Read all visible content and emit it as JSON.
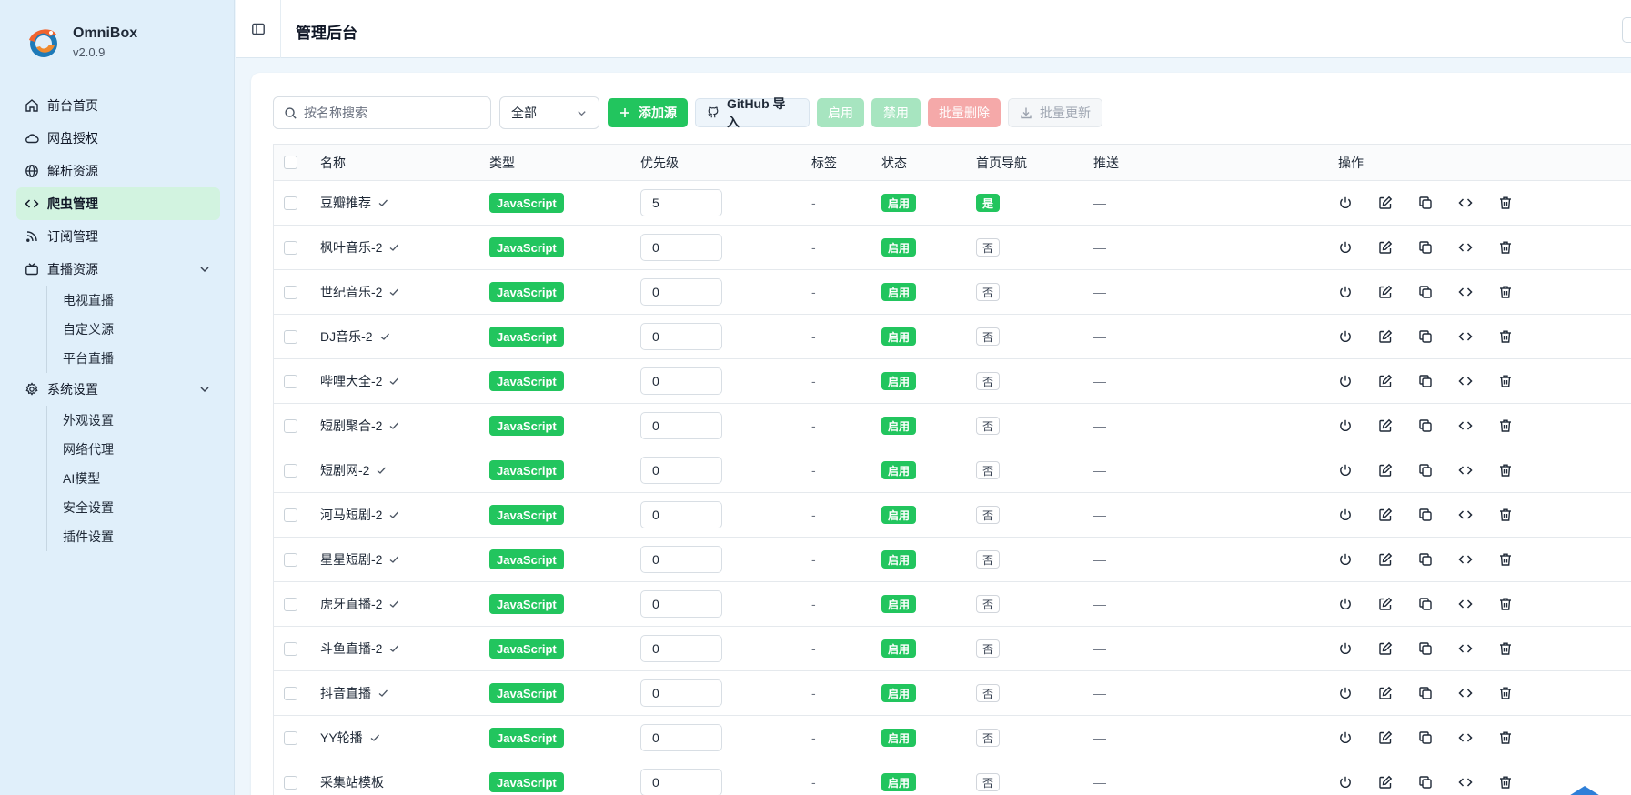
{
  "app": {
    "name": "OmniBox",
    "version": "v2.0.9"
  },
  "sidebar": {
    "items": [
      {
        "label": "前台首页",
        "icon": "home-icon"
      },
      {
        "label": "网盘授权",
        "icon": "cloud-icon"
      },
      {
        "label": "解析资源",
        "icon": "globe-icon"
      },
      {
        "label": "爬虫管理",
        "icon": "code-icon",
        "active": true
      },
      {
        "label": "订阅管理",
        "icon": "rss-icon"
      },
      {
        "label": "直播资源",
        "icon": "tv-icon",
        "expanded": true
      },
      {
        "label": "系统设置",
        "icon": "gear-icon",
        "expanded": true
      }
    ],
    "live_sub": [
      "电视直播",
      "自定义源",
      "平台直播"
    ],
    "settings_sub": [
      "外观设置",
      "网络代理",
      "AI模型",
      "安全设置",
      "插件设置"
    ]
  },
  "header": {
    "title": "管理后台"
  },
  "toolbar": {
    "search_placeholder": "按名称搜索",
    "filter_value": "全部",
    "add_label": "添加源",
    "github_label": "GitHub 导入",
    "enable_label": "启用",
    "disable_label": "禁用",
    "delete_label": "批量删除",
    "update_label": "批量更新"
  },
  "table": {
    "headers": {
      "name": "名称",
      "type": "类型",
      "priority": "优先级",
      "tags": "标签",
      "status": "状态",
      "home_nav": "首页导航",
      "push": "推送",
      "actions": "操作"
    },
    "rows": [
      {
        "name": "豆瓣推荐",
        "type": "JavaScript",
        "priority": "5",
        "tags": "-",
        "status": "启用",
        "home_nav": "是",
        "push": "—"
      },
      {
        "name": "枫叶音乐-2",
        "type": "JavaScript",
        "priority": "0",
        "tags": "-",
        "status": "启用",
        "home_nav": "否",
        "push": "—"
      },
      {
        "name": "世纪音乐-2",
        "type": "JavaScript",
        "priority": "0",
        "tags": "-",
        "status": "启用",
        "home_nav": "否",
        "push": "—"
      },
      {
        "name": "DJ音乐-2",
        "type": "JavaScript",
        "priority": "0",
        "tags": "-",
        "status": "启用",
        "home_nav": "否",
        "push": "—"
      },
      {
        "name": "哔哩大全-2",
        "type": "JavaScript",
        "priority": "0",
        "tags": "-",
        "status": "启用",
        "home_nav": "否",
        "push": "—"
      },
      {
        "name": "短剧聚合-2",
        "type": "JavaScript",
        "priority": "0",
        "tags": "-",
        "status": "启用",
        "home_nav": "否",
        "push": "—"
      },
      {
        "name": "短剧网-2",
        "type": "JavaScript",
        "priority": "0",
        "tags": "-",
        "status": "启用",
        "home_nav": "否",
        "push": "—"
      },
      {
        "name": "河马短剧-2",
        "type": "JavaScript",
        "priority": "0",
        "tags": "-",
        "status": "启用",
        "home_nav": "否",
        "push": "—"
      },
      {
        "name": "星星短剧-2",
        "type": "JavaScript",
        "priority": "0",
        "tags": "-",
        "status": "启用",
        "home_nav": "否",
        "push": "—"
      },
      {
        "name": "虎牙直播-2",
        "type": "JavaScript",
        "priority": "0",
        "tags": "-",
        "status": "启用",
        "home_nav": "否",
        "push": "—"
      },
      {
        "name": "斗鱼直播-2",
        "type": "JavaScript",
        "priority": "0",
        "tags": "-",
        "status": "启用",
        "home_nav": "否",
        "push": "—"
      },
      {
        "name": "抖音直播",
        "type": "JavaScript",
        "priority": "0",
        "tags": "-",
        "status": "启用",
        "home_nav": "否",
        "push": "—"
      },
      {
        "name": "YY轮播",
        "type": "JavaScript",
        "priority": "0",
        "tags": "-",
        "status": "启用",
        "home_nav": "否",
        "push": "—"
      },
      {
        "name": "采集站模板",
        "type": "JavaScript",
        "priority": "0",
        "tags": "-",
        "status": "启用",
        "home_nav": "否",
        "push": "—",
        "no_check": true
      }
    ]
  },
  "colors": {
    "accent": "#22c55e",
    "sidebar_bg": "#e0effa",
    "active_bg": "#d2f3e0",
    "danger_light": "#f5a9a9"
  }
}
